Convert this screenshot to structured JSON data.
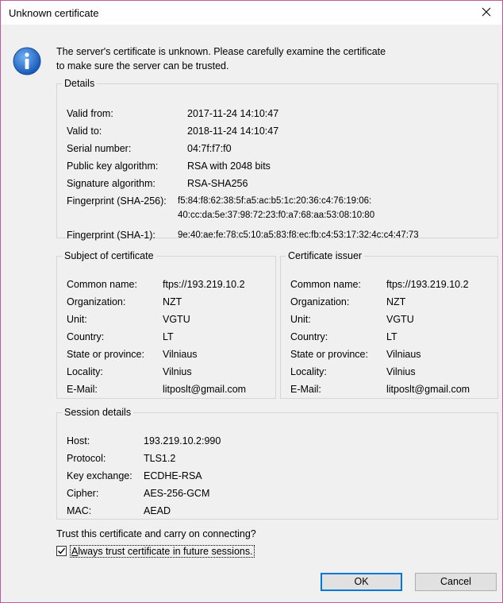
{
  "window": {
    "title": "Unknown certificate"
  },
  "message": {
    "line1": "The server's certificate is unknown. Please carefully examine the certificate",
    "line2": "to make sure the server can be trusted."
  },
  "details": {
    "legend": "Details",
    "rows": [
      {
        "label": "Valid from:",
        "value": "2017-11-24 14:10:47"
      },
      {
        "label": "Valid to:",
        "value": "2018-11-24 14:10:47"
      },
      {
        "label": "Serial number:",
        "value": "04:7f:f7:f0"
      },
      {
        "label": "Public key algorithm:",
        "value": "RSA with 2048 bits"
      },
      {
        "label": "Signature algorithm:",
        "value": "RSA-SHA256"
      }
    ],
    "sha256_label": "Fingerprint (SHA-256):",
    "sha256_line1": "f5:84:f8:62:38:5f:a5:ac:b5:1c:20:36:c4:76:19:06:",
    "sha256_line2": "40:cc:da:5e:37:98:72:23:f0:a7:68:aa:53:08:10:80",
    "sha1_label": "Fingerprint (SHA-1):",
    "sha1_value": "9e:40:ae:fe:78:c5:10:a5:83:f8:ec:fb:c4:53:17:32:4c:c4:47:73"
  },
  "subject": {
    "legend": "Subject of certificate",
    "rows": [
      {
        "label": "Common name:",
        "value": "ftps://193.219.10.2"
      },
      {
        "label": "Organization:",
        "value": "NZT"
      },
      {
        "label": "Unit:",
        "value": "VGTU"
      },
      {
        "label": "Country:",
        "value": "LT"
      },
      {
        "label": "State or province:",
        "value": "Vilniaus"
      },
      {
        "label": "Locality:",
        "value": "Vilnius"
      },
      {
        "label": "E-Mail:",
        "value": "litposlt@gmail.com"
      }
    ]
  },
  "issuer": {
    "legend": "Certificate issuer",
    "rows": [
      {
        "label": "Common name:",
        "value": "ftps://193.219.10.2"
      },
      {
        "label": "Organization:",
        "value": "NZT"
      },
      {
        "label": "Unit:",
        "value": "VGTU"
      },
      {
        "label": "Country:",
        "value": "LT"
      },
      {
        "label": "State or province:",
        "value": "Vilniaus"
      },
      {
        "label": "Locality:",
        "value": "Vilnius"
      },
      {
        "label": "E-Mail:",
        "value": "litposlt@gmail.com"
      }
    ]
  },
  "session": {
    "legend": "Session details",
    "rows": [
      {
        "label": "Host:",
        "value": "193.219.10.2:990"
      },
      {
        "label": "Protocol:",
        "value": "TLS1.2"
      },
      {
        "label": "Key exchange:",
        "value": "ECDHE-RSA"
      },
      {
        "label": "Cipher:",
        "value": "AES-256-GCM"
      },
      {
        "label": "MAC:",
        "value": "AEAD"
      }
    ]
  },
  "trust": {
    "question": "Trust this certificate and carry on connecting?",
    "checkbox_label": "Always trust certificate in future sessions.",
    "checked": true
  },
  "buttons": {
    "ok": "OK",
    "cancel": "Cancel"
  },
  "colors": {
    "window_border": "#c7569a",
    "info_icon": "#1f6fd0",
    "default_button": "#0078d7"
  },
  "icons": {
    "info": "info-icon",
    "close": "close-icon",
    "check": "check-icon"
  }
}
